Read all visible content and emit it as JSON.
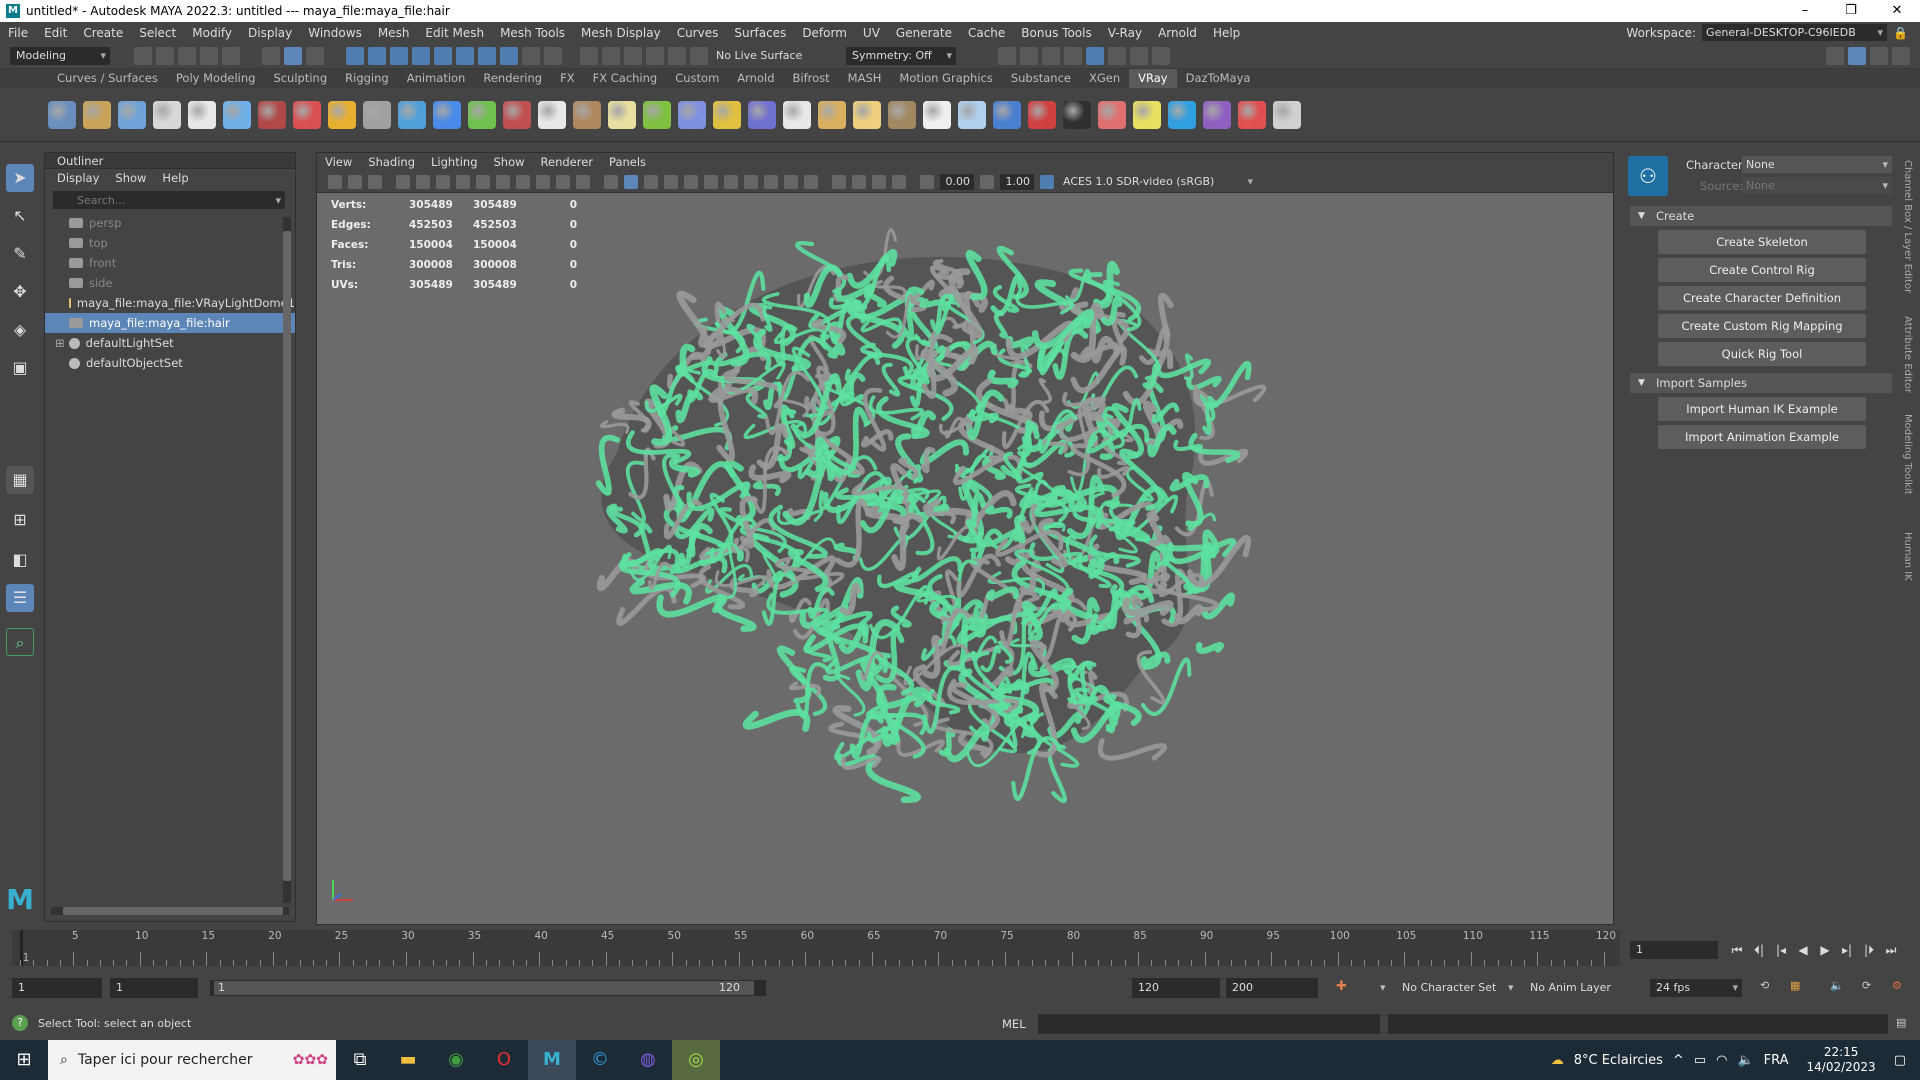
{
  "window": {
    "title": "untitled* - Autodesk MAYA 2022.3: untitled   ---   maya_file:maya_file:hair",
    "minimize": "–",
    "maximize": "❐",
    "close": "✕"
  },
  "menubar": {
    "items": [
      "File",
      "Edit",
      "Create",
      "Select",
      "Modify",
      "Display",
      "Windows",
      "Mesh",
      "Edit Mesh",
      "Mesh Tools",
      "Mesh Display",
      "Curves",
      "Surfaces",
      "Deform",
      "UV",
      "Generate",
      "Cache",
      "Bonus Tools",
      "V-Ray",
      "Arnold",
      "Help"
    ],
    "workspace_label": "Workspace:",
    "workspace_value": "General-DESKTOP-C96IEDB"
  },
  "statusline": {
    "mode": "Modeling",
    "live_surface": "No Live Surface",
    "symmetry": "Symmetry: Off"
  },
  "shelf": {
    "tabs": [
      "Curves / Surfaces",
      "Poly Modeling",
      "Sculpting",
      "Rigging",
      "Animation",
      "Rendering",
      "FX",
      "FX Caching",
      "Custom",
      "Arnold",
      "Bifrost",
      "MASH",
      "Motion Graphics",
      "Substance",
      "XGen",
      "VRay",
      "DazToMaya"
    ],
    "active_tab": "VRay",
    "icon_colors": [
      "#6a8fbf",
      "#c9a35a",
      "#6fa3d8",
      "#d8d8d8",
      "#e8e8e8",
      "#6fb0e8",
      "#b04848",
      "#d85050",
      "#e8b030",
      "#a0a0a0",
      "#4fa0d8",
      "#4a8ae8",
      "#70c050",
      "#c05050",
      "#e8e8e8",
      "#b08860",
      "#e8e0a0",
      "#80c040",
      "#8090e0",
      "#e0c040",
      "#7070d0",
      "#e8e8e8",
      "#d8b060",
      "#f0d080",
      "#a08860",
      "#f0f0f0",
      "#b0d0f0",
      "#4a80d0",
      "#d04040",
      "#303030",
      "#e07070",
      "#e8e060",
      "#30a0e0",
      "#9060c0",
      "#e05050",
      "#d0d0d0"
    ]
  },
  "toolbox": {
    "icons": [
      "select-tool-icon",
      "lasso-tool-icon",
      "paint-select-icon",
      "move-tool-icon",
      "rotate-tool-icon",
      "scale-tool-icon"
    ]
  },
  "outliner": {
    "title": "Outliner",
    "menu": [
      "Display",
      "Show",
      "Help"
    ],
    "search_placeholder": "Search...",
    "items": [
      {
        "label": "persp",
        "dim": true
      },
      {
        "label": "top",
        "dim": true
      },
      {
        "label": "front",
        "dim": true
      },
      {
        "label": "side",
        "dim": true
      },
      {
        "label": "maya_file:maya_file:VRayLightDome1",
        "dim": false
      },
      {
        "label": "maya_file:maya_file:hair",
        "dim": false,
        "selected": true
      },
      {
        "label": "defaultLightSet",
        "dim": false,
        "expand": "⊞"
      },
      {
        "label": "defaultObjectSet",
        "dim": false
      }
    ]
  },
  "viewport": {
    "menu": [
      "View",
      "Shading",
      "Lighting",
      "Show",
      "Renderer",
      "Panels"
    ],
    "exposure": "0.00",
    "gamma": "1.00",
    "color_space": "ACES 1.0 SDR-video (sRGB)",
    "hud": [
      {
        "label": "Verts:",
        "a": "305489",
        "b": "305489",
        "c": "0"
      },
      {
        "label": "Edges:",
        "a": "452503",
        "b": "452503",
        "c": "0"
      },
      {
        "label": "Faces:",
        "a": "150004",
        "b": "150004",
        "c": "0"
      },
      {
        "label": "Tris:",
        "a": "300008",
        "b": "300008",
        "c": "0"
      },
      {
        "label": "UVs:",
        "a": "305489",
        "b": "305489",
        "c": "0"
      }
    ],
    "wire_color": "#5de0a0"
  },
  "hik": {
    "character_label": "Character:",
    "character_value": "None",
    "source_label": "Source:",
    "source_value": "None",
    "create_section": "Create",
    "create_buttons": [
      "Create Skeleton",
      "Create Control Rig",
      "Create Character Definition",
      "Create Custom Rig Mapping",
      "Quick Rig Tool"
    ],
    "import_section": "Import Samples",
    "import_buttons": [
      "Import Human IK Example",
      "Import Animation Example"
    ]
  },
  "sidetabs": [
    "Channel Box / Layer Editor",
    "Attribute Editor",
    "Modeling Toolkit",
    "Human IK"
  ],
  "timeslider": {
    "ticks": [
      5,
      10,
      15,
      20,
      25,
      30,
      35,
      40,
      45,
      50,
      55,
      60,
      65,
      70,
      75,
      80,
      85,
      90,
      95,
      100,
      105,
      110,
      115,
      120
    ],
    "start": 1,
    "end": 120,
    "current_frame": "1"
  },
  "rangebar": {
    "start": "1",
    "anim_start": "1",
    "range_start": "1",
    "range_end": "120",
    "anim_end_field": "120",
    "end_field": "200",
    "character_set": "No Character Set",
    "anim_layer": "No Anim Layer",
    "fps": "24 fps"
  },
  "cmdline": {
    "help": "Select Tool: select an object",
    "lang": "MEL"
  },
  "taskbar": {
    "search_placeholder": "Taper ici pour rechercher",
    "weather": "8°C  Eclaircies",
    "lang": "FRA",
    "time": "22:15",
    "date": "14/02/2023"
  }
}
